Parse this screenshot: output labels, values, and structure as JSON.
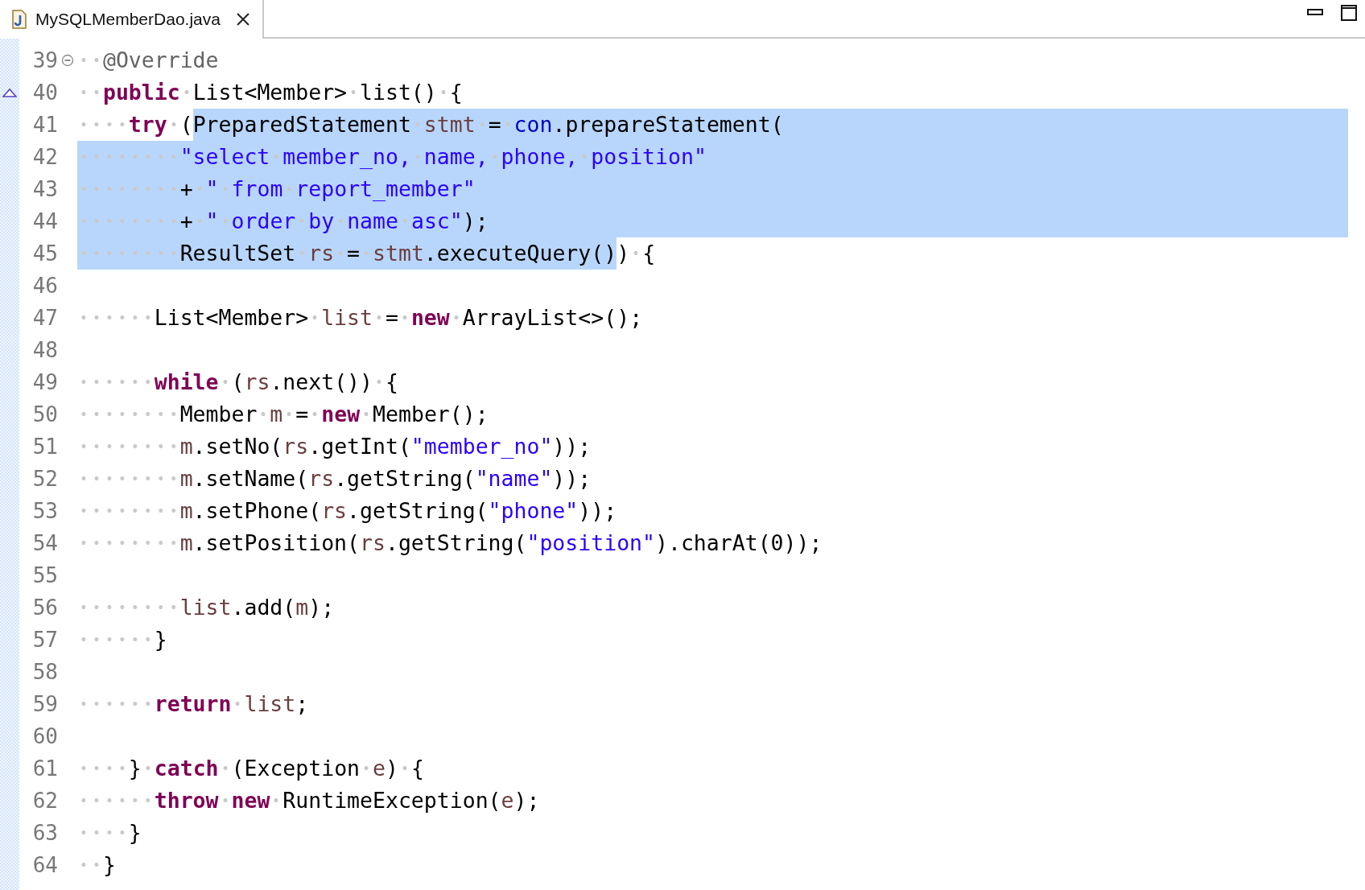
{
  "tabs": [
    {
      "label": "MySQLMemberDao.java",
      "selected": true
    }
  ],
  "lines": [
    {
      "number": "39",
      "fold_expanded": true,
      "tokens": [
        {
          "kind": "annotation",
          "text": "  @Override"
        }
      ]
    },
    {
      "number": "40",
      "override_marker": true,
      "tokens": [
        {
          "kind": "keyword",
          "text": "  public"
        },
        {
          "kind": "plain",
          "text": " List<Member> list() {"
        }
      ]
    },
    {
      "number": "41",
      "selected_to_end": true,
      "tokens": [
        {
          "kind": "keyword",
          "text": "    try",
          "selected": false
        },
        {
          "kind": "plain",
          "text": " (",
          "selected": false
        },
        {
          "kind": "plain",
          "text": "PreparedStatement ",
          "selected": true
        },
        {
          "kind": "variable",
          "text": "stmt",
          "selected": true
        },
        {
          "kind": "plain",
          "text": " = ",
          "selected": true
        },
        {
          "kind": "field",
          "text": "con",
          "selected": true
        },
        {
          "kind": "plain",
          "text": ".prepareStatement(",
          "selected": true
        }
      ]
    },
    {
      "number": "42",
      "selected_to_end": true,
      "tokens": [
        {
          "kind": "string",
          "text": "        \"select member_no, name, phone, position\"",
          "selected": true
        }
      ]
    },
    {
      "number": "43",
      "selected_to_end": true,
      "tokens": [
        {
          "kind": "plain",
          "text": "        + ",
          "selected": true
        },
        {
          "kind": "string",
          "text": "\" from report_member\"",
          "selected": true
        }
      ]
    },
    {
      "number": "44",
      "selected_to_end": true,
      "tokens": [
        {
          "kind": "plain",
          "text": "        + ",
          "selected": true
        },
        {
          "kind": "string",
          "text": "\" order by name asc\"",
          "selected": true
        },
        {
          "kind": "plain",
          "text": ");",
          "selected": true
        }
      ]
    },
    {
      "number": "45",
      "selected_to_end": false,
      "tokens": [
        {
          "kind": "plain",
          "text": "        ResultSet ",
          "selected": true
        },
        {
          "kind": "variable",
          "text": "rs",
          "selected": true
        },
        {
          "kind": "plain",
          "text": " = ",
          "selected": true
        },
        {
          "kind": "variable",
          "text": "stmt",
          "selected": true
        },
        {
          "kind": "plain",
          "text": ".executeQuery()",
          "selected": true
        },
        {
          "kind": "plain",
          "text": ") {",
          "selected": false
        }
      ]
    },
    {
      "number": "46"
    },
    {
      "number": "47",
      "tokens": [
        {
          "kind": "plain",
          "text": "      List<Member> "
        },
        {
          "kind": "variable",
          "text": "list"
        },
        {
          "kind": "plain",
          "text": " = "
        },
        {
          "kind": "keyword",
          "text": "new"
        },
        {
          "kind": "plain",
          "text": " ArrayList<>();"
        }
      ]
    },
    {
      "number": "48"
    },
    {
      "number": "49",
      "tokens": [
        {
          "kind": "keyword",
          "text": "      while"
        },
        {
          "kind": "plain",
          "text": " ("
        },
        {
          "kind": "variable",
          "text": "rs"
        },
        {
          "kind": "plain",
          "text": ".next()) {"
        }
      ]
    },
    {
      "number": "50",
      "tokens": [
        {
          "kind": "plain",
          "text": "        Member "
        },
        {
          "kind": "variable",
          "text": "m"
        },
        {
          "kind": "plain",
          "text": " = "
        },
        {
          "kind": "keyword",
          "text": "new"
        },
        {
          "kind": "plain",
          "text": " Member();"
        }
      ]
    },
    {
      "number": "51",
      "tokens": [
        {
          "kind": "variable",
          "text": "        m"
        },
        {
          "kind": "plain",
          "text": ".setNo("
        },
        {
          "kind": "variable",
          "text": "rs"
        },
        {
          "kind": "plain",
          "text": ".getInt("
        },
        {
          "kind": "string",
          "text": "\"member_no\""
        },
        {
          "kind": "plain",
          "text": "));"
        }
      ]
    },
    {
      "number": "52",
      "tokens": [
        {
          "kind": "variable",
          "text": "        m"
        },
        {
          "kind": "plain",
          "text": ".setName("
        },
        {
          "kind": "variable",
          "text": "rs"
        },
        {
          "kind": "plain",
          "text": ".getString("
        },
        {
          "kind": "string",
          "text": "\"name\""
        },
        {
          "kind": "plain",
          "text": "));"
        }
      ]
    },
    {
      "number": "53",
      "tokens": [
        {
          "kind": "variable",
          "text": "        m"
        },
        {
          "kind": "plain",
          "text": ".setPhone("
        },
        {
          "kind": "variable",
          "text": "rs"
        },
        {
          "kind": "plain",
          "text": ".getString("
        },
        {
          "kind": "string",
          "text": "\"phone\""
        },
        {
          "kind": "plain",
          "text": "));"
        }
      ]
    },
    {
      "number": "54",
      "tokens": [
        {
          "kind": "variable",
          "text": "        m"
        },
        {
          "kind": "plain",
          "text": ".setPosition("
        },
        {
          "kind": "variable",
          "text": "rs"
        },
        {
          "kind": "plain",
          "text": ".getString("
        },
        {
          "kind": "string",
          "text": "\"position\""
        },
        {
          "kind": "plain",
          "text": ").charAt(0));"
        }
      ]
    },
    {
      "number": "55"
    },
    {
      "number": "56",
      "tokens": [
        {
          "kind": "variable",
          "text": "        list"
        },
        {
          "kind": "plain",
          "text": ".add("
        },
        {
          "kind": "variable",
          "text": "m"
        },
        {
          "kind": "plain",
          "text": ");"
        }
      ]
    },
    {
      "number": "57",
      "tokens": [
        {
          "kind": "plain",
          "text": "      }"
        }
      ]
    },
    {
      "number": "58"
    },
    {
      "number": "59",
      "tokens": [
        {
          "kind": "keyword",
          "text": "      return "
        },
        {
          "kind": "variable",
          "text": "list"
        },
        {
          "kind": "plain",
          "text": ";"
        }
      ]
    },
    {
      "number": "60"
    },
    {
      "number": "61",
      "tokens": [
        {
          "kind": "plain",
          "text": "    } "
        },
        {
          "kind": "keyword",
          "text": "catch"
        },
        {
          "kind": "plain",
          "text": " (Exception "
        },
        {
          "kind": "variable",
          "text": "e"
        },
        {
          "kind": "plain",
          "text": ") {"
        }
      ]
    },
    {
      "number": "62",
      "tokens": [
        {
          "kind": "keyword",
          "text": "      throw "
        },
        {
          "kind": "keyword",
          "text": "new"
        },
        {
          "kind": "plain",
          "text": " RuntimeException("
        },
        {
          "kind": "variable",
          "text": "e"
        },
        {
          "kind": "plain",
          "text": ");"
        }
      ]
    },
    {
      "number": "63",
      "tokens": [
        {
          "kind": "plain",
          "text": "    }"
        }
      ]
    },
    {
      "number": "64",
      "tokens": [
        {
          "kind": "plain",
          "text": "  }"
        }
      ]
    }
  ]
}
